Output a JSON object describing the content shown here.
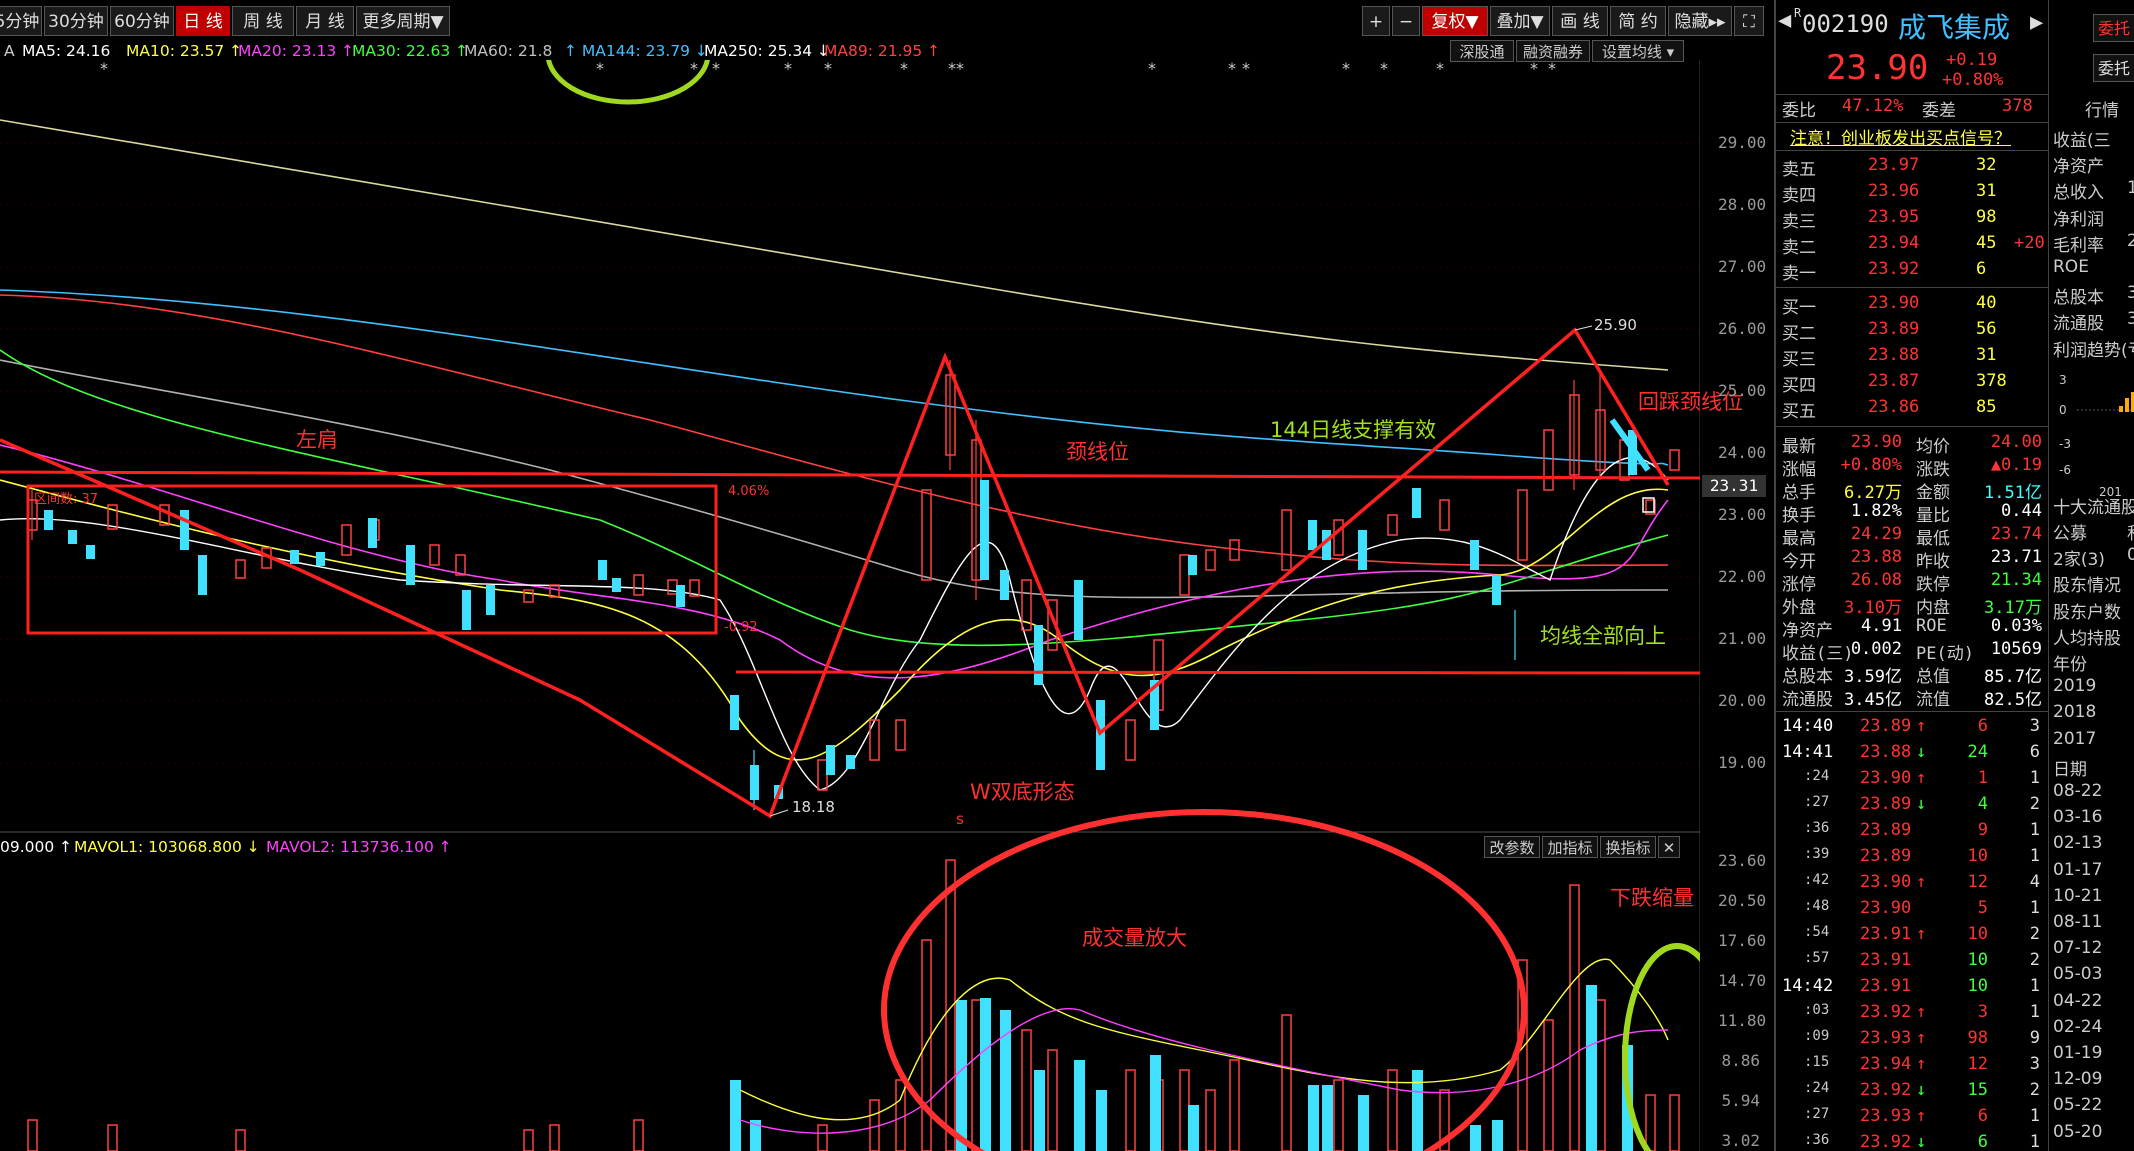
{
  "toolbar": {
    "periods": [
      "5分钟",
      "30分钟",
      "60分钟",
      "日 线",
      "周 线",
      "月 线",
      "更多周期▼"
    ],
    "active_period": "日 线",
    "right_buttons": [
      "+",
      "−",
      "复权▼",
      "叠加▼",
      "画 线",
      "简 约",
      "隐藏▸▸"
    ]
  },
  "ma_line": [
    {
      "label": "MA5: 24.16",
      "color": "#ffffff"
    },
    {
      "label": "MA10: 23.57 ↑",
      "color": "#ffff40"
    },
    {
      "label": "MA20: 23.13 ↑",
      "color": "#ff40ff"
    },
    {
      "label": "MA30: 22.63 ↑",
      "color": "#40ff40"
    },
    {
      "label": "MA60: 21.8",
      "color": "#c0c0c0"
    },
    {
      "label": "↑ MA144: 23.79 ↓",
      "color": "#40c0ff"
    },
    {
      "label": "MA250: 25.34 ↓",
      "color": "#ffffff"
    },
    {
      "label": "MA89: 21.95 ↑",
      "color": "#ff4040"
    }
  ],
  "chart_buttons": [
    "深股通",
    "融资融券",
    "设置均线 ▾"
  ],
  "vol_buttons": [
    "改参数",
    "加指标",
    "换指标",
    "✕"
  ],
  "vol_indicator": [
    {
      "label": "09.000 ↑",
      "color": "#ffffff"
    },
    {
      "label": "MAVOL1: 103068.800 ↓",
      "color": "#ffff40"
    },
    {
      "label": "MAVOL2: 113736.100 ↑",
      "color": "#ff40ff"
    }
  ],
  "price_axis": [
    "29.00",
    "28.00",
    "27.00",
    "26.00",
    "25.00",
    "24.00",
    "23.00",
    "22.00",
    "21.00",
    "20.00",
    "19.00"
  ],
  "current_price_tag": "23.31",
  "volume_axis": [
    "23.60",
    "20.50",
    "17.60",
    "14.70",
    "11.80",
    "8.86",
    "5.94",
    "3.02"
  ],
  "annotations": {
    "left_shoulder": "左肩",
    "neckline": "颈线位",
    "ma144_support": "144日线支撑有效",
    "pullback": "回踩颈线位",
    "all_ma_up": "均线全部向上",
    "w_bottom": "W双底形态",
    "high_label": "25.90",
    "low_label": "18.18",
    "box_top": "4.06%",
    "box_bottom": "-0.92",
    "box_days": "区间数: 37",
    "volume_up": "成交量放大",
    "volume_down": "下跌缩量",
    "s_mark": "s"
  },
  "quote": {
    "code": "002190",
    "name": "成飞集成",
    "price": "23.90",
    "change": "+0.19",
    "change_pct": "+0.80%",
    "weibi_label": "委比",
    "weibi": "47.12%",
    "weicha_label": "委差",
    "weicha": "378",
    "notice": "注意！创业板发出买点信号？",
    "asks": [
      {
        "label": "卖五",
        "price": "23.97",
        "vol": "32",
        "extra": ""
      },
      {
        "label": "卖四",
        "price": "23.96",
        "vol": "31",
        "extra": ""
      },
      {
        "label": "卖三",
        "price": "23.95",
        "vol": "98",
        "extra": ""
      },
      {
        "label": "卖二",
        "price": "23.94",
        "vol": "45",
        "extra": "+20"
      },
      {
        "label": "卖一",
        "price": "23.92",
        "vol": "6",
        "extra": ""
      }
    ],
    "bids": [
      {
        "label": "买一",
        "price": "23.90",
        "vol": "40"
      },
      {
        "label": "买二",
        "price": "23.89",
        "vol": "56"
      },
      {
        "label": "买三",
        "price": "23.88",
        "vol": "31"
      },
      {
        "label": "买四",
        "price": "23.87",
        "vol": "378"
      },
      {
        "label": "买五",
        "price": "23.86",
        "vol": "85"
      }
    ],
    "stats": [
      {
        "l1": "最新",
        "v1": "23.90",
        "c1": "#ff3333",
        "l2": "均价",
        "v2": "24.00",
        "c2": "#ff3333"
      },
      {
        "l1": "涨幅",
        "v1": "+0.80%",
        "c1": "#ff3333",
        "l2": "涨跌",
        "v2": "▲0.19",
        "c2": "#ff3333"
      },
      {
        "l1": "总手",
        "v1": "6.27万",
        "c1": "#ffff40",
        "l2": "金额",
        "v2": "1.51亿",
        "c2": "#40ffff"
      },
      {
        "l1": "换手",
        "v1": "1.82%",
        "c1": "#ffffff",
        "l2": "量比",
        "v2": "0.44",
        "c2": "#ffffff"
      },
      {
        "l1": "最高",
        "v1": "24.29",
        "c1": "#ff3333",
        "l2": "最低",
        "v2": "23.74",
        "c2": "#ff3333"
      },
      {
        "l1": "今开",
        "v1": "23.88",
        "c1": "#ff3333",
        "l2": "昨收",
        "v2": "23.71",
        "c2": "#ffffff"
      },
      {
        "l1": "涨停",
        "v1": "26.08",
        "c1": "#ff3333",
        "l2": "跌停",
        "v2": "21.34",
        "c2": "#40ff40"
      },
      {
        "l1": "外盘",
        "v1": "3.10万",
        "c1": "#ff3333",
        "l2": "内盘",
        "v2": "3.17万",
        "c2": "#40ff40"
      },
      {
        "l1": "净资产",
        "v1": "4.91",
        "c1": "#ffffff",
        "l2": "ROE",
        "v2": "0.03%",
        "c2": "#ffffff"
      },
      {
        "l1": "收益(三)",
        "v1": "0.002",
        "c1": "#ffffff",
        "l2": "PE(动)",
        "v2": "10569",
        "c2": "#ffffff"
      },
      {
        "l1": "总股本",
        "v1": "3.59亿",
        "c1": "#ffffff",
        "l2": "总值",
        "v2": "85.7亿",
        "c2": "#ffffff"
      },
      {
        "l1": "流通股",
        "v1": "3.45亿",
        "c1": "#ffffff",
        "l2": "流值",
        "v2": "82.5亿",
        "c2": "#ffffff"
      }
    ],
    "ticks": [
      {
        "time": "14:40",
        "price": "23.89",
        "arrow": "↑",
        "vol": "6",
        "n": "3",
        "ac": "#ff3333",
        "vc": "#ff3333"
      },
      {
        "time": "14:41",
        "price": "23.88",
        "arrow": "↓",
        "vol": "24",
        "n": "6",
        "ac": "#40ff40",
        "vc": "#40ff40"
      },
      {
        "time": ":24",
        "price": "23.90",
        "arrow": "↑",
        "vol": "1",
        "n": "1",
        "ac": "#ff3333",
        "vc": "#ff3333"
      },
      {
        "time": ":27",
        "price": "23.89",
        "arrow": "↓",
        "vol": "4",
        "n": "2",
        "ac": "#40ff40",
        "vc": "#40ff40"
      },
      {
        "time": ":36",
        "price": "23.89",
        "arrow": "",
        "vol": "9",
        "n": "1",
        "ac": "#ff3333",
        "vc": "#ff3333"
      },
      {
        "time": ":39",
        "price": "23.89",
        "arrow": "",
        "vol": "10",
        "n": "1",
        "ac": "#ff3333",
        "vc": "#ff3333"
      },
      {
        "time": ":42",
        "price": "23.90",
        "arrow": "↑",
        "vol": "12",
        "n": "4",
        "ac": "#ff3333",
        "vc": "#ff3333"
      },
      {
        "time": ":48",
        "price": "23.90",
        "arrow": "",
        "vol": "5",
        "n": "1",
        "ac": "#ff3333",
        "vc": "#ff3333"
      },
      {
        "time": ":54",
        "price": "23.91",
        "arrow": "↑",
        "vol": "10",
        "n": "2",
        "ac": "#ff3333",
        "vc": "#ff3333"
      },
      {
        "time": ":57",
        "price": "23.91",
        "arrow": "",
        "vol": "10",
        "n": "2",
        "ac": "#ff3333",
        "vc": "#40ff40"
      },
      {
        "time": "14:42",
        "price": "23.91",
        "arrow": "",
        "vol": "10",
        "n": "1",
        "ac": "#ff3333",
        "vc": "#40ff40"
      },
      {
        "time": ":03",
        "price": "23.92",
        "arrow": "↑",
        "vol": "3",
        "n": "1",
        "ac": "#ff3333",
        "vc": "#ff3333"
      },
      {
        "time": ":09",
        "price": "23.93",
        "arrow": "↑",
        "vol": "98",
        "n": "9",
        "ac": "#ff3333",
        "vc": "#ff3333"
      },
      {
        "time": ":15",
        "price": "23.94",
        "arrow": "↑",
        "vol": "12",
        "n": "3",
        "ac": "#ff3333",
        "vc": "#ff3333"
      },
      {
        "time": ":24",
        "price": "23.92",
        "arrow": "↓",
        "vol": "15",
        "n": "2",
        "ac": "#40ff40",
        "vc": "#40ff40"
      },
      {
        "time": ":27",
        "price": "23.93",
        "arrow": "↑",
        "vol": "6",
        "n": "1",
        "ac": "#ff3333",
        "vc": "#ff3333"
      },
      {
        "time": ":36",
        "price": "23.92",
        "arrow": "↓",
        "vol": "6",
        "n": "1",
        "ac": "#40ff40",
        "vc": "#40ff40"
      }
    ]
  },
  "side": {
    "top_btn": "委托",
    "top_btn2": "委托",
    "header": "行情",
    "items": [
      "收益(三",
      "净资产",
      "总收入",
      "净利润",
      "毛利率",
      "ROE",
      "总股本",
      "流通股",
      "利润趋势(亏",
      "",
      "",
      "",
      "",
      "",
      "十大流通股",
      "公募",
      "2家(3)",
      "股东情况",
      "股东户数",
      "人均持股",
      "年份",
      "2019",
      "2018",
      "2017",
      "日期",
      "08-22",
      "03-16",
      "02-13",
      "01-17",
      "10-21",
      "08-11",
      "07-12",
      "05-03",
      "04-22",
      "02-24",
      "01-19",
      "12-09",
      "05-22",
      "05-20"
    ],
    "values": [
      "",
      "",
      "1",
      "",
      "2",
      "",
      "3",
      "3",
      "",
      "",
      "",
      "",
      "",
      "",
      "",
      "私",
      "0",
      "",
      "",
      "",
      "",
      "",
      "",
      "",
      "",
      "",
      "",
      "",
      "",
      "",
      "",
      "",
      "",
      "",
      "",
      "",
      "",
      "",
      ""
    ]
  }
}
